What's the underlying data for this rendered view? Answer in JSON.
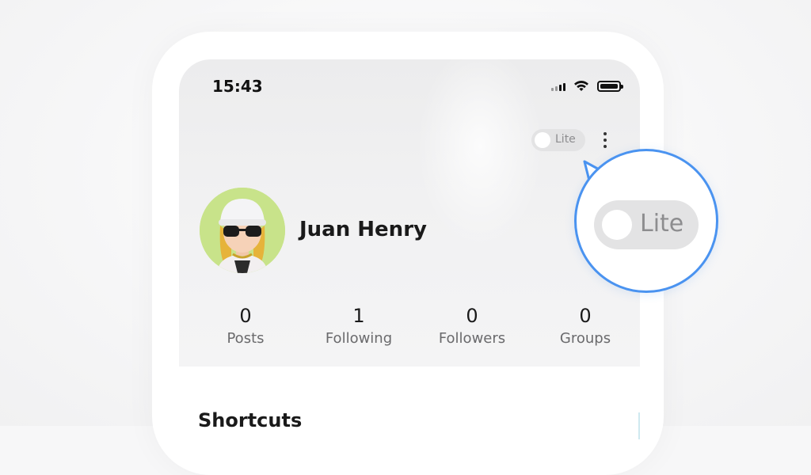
{
  "status_bar": {
    "time": "15:43"
  },
  "top_actions": {
    "lite_label": "Lite",
    "more_icon": "more-vertical-icon"
  },
  "profile": {
    "name": "Juan Henry"
  },
  "stats": [
    {
      "value": "0",
      "label": "Posts"
    },
    {
      "value": "1",
      "label": "Following"
    },
    {
      "value": "0",
      "label": "Followers"
    },
    {
      "value": "0",
      "label": "Groups"
    }
  ],
  "sections": {
    "shortcuts_title": "Shortcuts"
  },
  "callout": {
    "lite_label": "Lite"
  },
  "colors": {
    "accent": "#4a93f0",
    "avatar_bg": "#c8e38a",
    "toggle_bg": "#e3e3e4"
  }
}
